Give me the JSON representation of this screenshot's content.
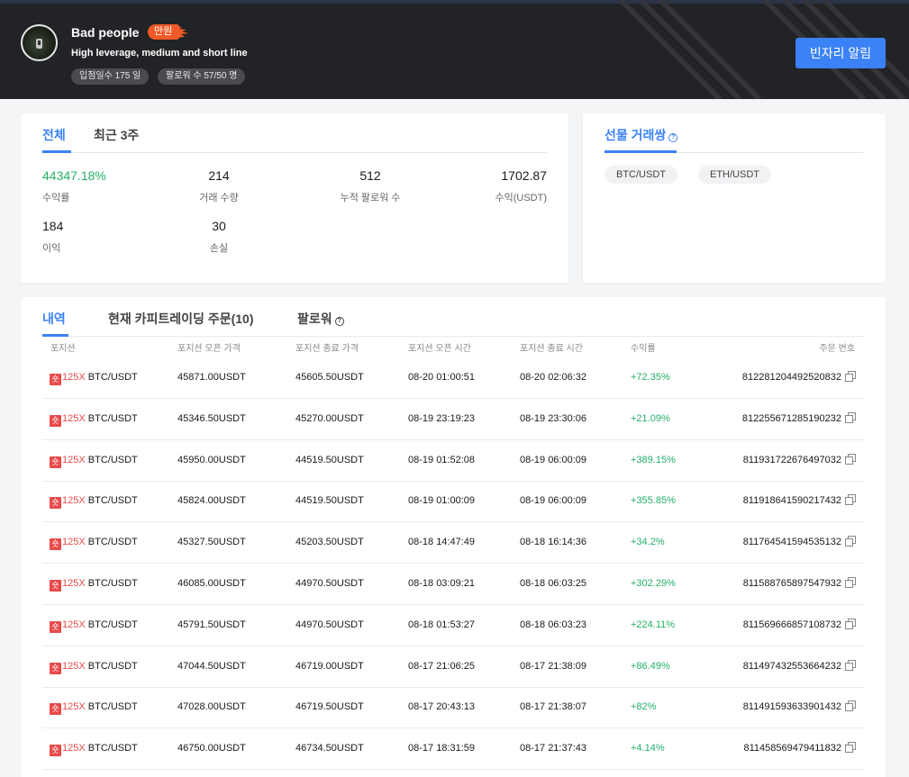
{
  "header": {
    "name": "Bad people",
    "badge": "만원",
    "tagline": "High leverage, medium and short line",
    "days_label": "입점일수 175 일",
    "followers_label": "팔로워 수 57/50 명",
    "alert_button": "빈자리 알림"
  },
  "stats_card": {
    "tabs": [
      "전체",
      "최근 3주"
    ],
    "stats": [
      {
        "value": "44347.18%",
        "label": "수익률"
      },
      {
        "value": "214",
        "label": "거래 수량"
      },
      {
        "value": "512",
        "label": "누적 팔로워 수"
      },
      {
        "value": "1702.87",
        "label": "수익(USDT)"
      },
      {
        "value": "184",
        "label": "이익"
      },
      {
        "value": "30",
        "label": "손실"
      }
    ]
  },
  "pairs_card": {
    "title": "선물 거래쌍",
    "help": "?",
    "pairs": [
      "BTC/USDT",
      "ETH/USDT"
    ]
  },
  "orders": {
    "tabs": [
      {
        "label": "내역"
      },
      {
        "label": "현재 카피트레이딩 주문(10)"
      },
      {
        "label": "팔로워",
        "help": "?"
      }
    ],
    "columns": [
      "포지션",
      "포지션 오픈 가격",
      "포지션 종료 가격",
      "포지션 오픈 시간",
      "포지션 종료 시간",
      "수익률",
      "주문 번호"
    ],
    "rows": [
      {
        "side": "숏",
        "leverage": "125X",
        "pair": "BTC/USDT",
        "open": "45871.00USDT",
        "close": "45605.50USDT",
        "open_time": "08-20 01:00:51",
        "close_time": "08-20 02:06:32",
        "roi": "+72.35%",
        "order_no": "812281204492520832"
      },
      {
        "side": "숏",
        "leverage": "125X",
        "pair": "BTC/USDT",
        "open": "45346.50USDT",
        "close": "45270.00USDT",
        "open_time": "08-19 23:19:23",
        "close_time": "08-19 23:30:06",
        "roi": "+21.09%",
        "order_no": "812255671285190232"
      },
      {
        "side": "숏",
        "leverage": "125X",
        "pair": "BTC/USDT",
        "open": "45950.00USDT",
        "close": "44519.50USDT",
        "open_time": "08-19 01:52:08",
        "close_time": "08-19 06:00:09",
        "roi": "+389.15%",
        "order_no": "811931722676497032"
      },
      {
        "side": "숏",
        "leverage": "125X",
        "pair": "BTC/USDT",
        "open": "45824.00USDT",
        "close": "44519.50USDT",
        "open_time": "08-19 01:00:09",
        "close_time": "08-19 06:00:09",
        "roi": "+355.85%",
        "order_no": "811918641590217432"
      },
      {
        "side": "숏",
        "leverage": "125X",
        "pair": "BTC/USDT",
        "open": "45327.50USDT",
        "close": "45203.50USDT",
        "open_time": "08-18 14:47:49",
        "close_time": "08-18 16:14:36",
        "roi": "+34.2%",
        "order_no": "811764541594535132"
      },
      {
        "side": "숏",
        "leverage": "125X",
        "pair": "BTC/USDT",
        "open": "46085.00USDT",
        "close": "44970.50USDT",
        "open_time": "08-18 03:09:21",
        "close_time": "08-18 06:03:25",
        "roi": "+302.29%",
        "order_no": "811588765897547932"
      },
      {
        "side": "숏",
        "leverage": "125X",
        "pair": "BTC/USDT",
        "open": "45791.50USDT",
        "close": "44970.50USDT",
        "open_time": "08-18 01:53:27",
        "close_time": "08-18 06:03:23",
        "roi": "+224.11%",
        "order_no": "811569666857108732"
      },
      {
        "side": "숏",
        "leverage": "125X",
        "pair": "BTC/USDT",
        "open": "47044.50USDT",
        "close": "46719.00USDT",
        "open_time": "08-17 21:06:25",
        "close_time": "08-17 21:38:09",
        "roi": "+86.49%",
        "order_no": "811497432553664232"
      },
      {
        "side": "숏",
        "leverage": "125X",
        "pair": "BTC/USDT",
        "open": "47028.00USDT",
        "close": "46719.50USDT",
        "open_time": "08-17 20:43:13",
        "close_time": "08-17 21:38:07",
        "roi": "+82%",
        "order_no": "811491593633901432"
      },
      {
        "side": "숏",
        "leverage": "125X",
        "pair": "BTC/USDT",
        "open": "46750.00USDT",
        "close": "46734.50USDT",
        "open_time": "08-17 18:31:59",
        "close_time": "08-17 21:37:43",
        "roi": "+4.14%",
        "order_no": "811458569479411832"
      }
    ]
  },
  "colors": {
    "accent": "#3b82f6",
    "positive": "#23b06a",
    "short": "#e84a4a",
    "badge": "#f05a28",
    "header_bg": "#222326"
  }
}
